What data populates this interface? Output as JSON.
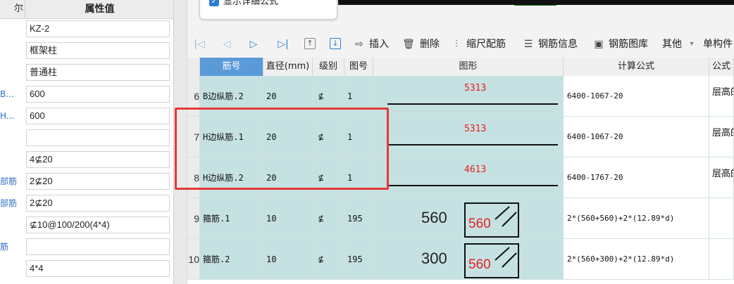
{
  "left_panel": {
    "header": {
      "name_col": "尔",
      "value_col": "属性值"
    },
    "rows": [
      {
        "name": "",
        "value": "KZ-2"
      },
      {
        "name": "",
        "value": "框架柱"
      },
      {
        "name": "",
        "value": "普通柱"
      },
      {
        "name": "B...",
        "value": "600"
      },
      {
        "name": "H...",
        "value": "600"
      },
      {
        "name": "",
        "value": ""
      },
      {
        "name": "",
        "value": "4⊈20"
      },
      {
        "name": "部筋",
        "value": "2⊈20"
      },
      {
        "name": "部筋",
        "value": "2⊈20"
      },
      {
        "name": "",
        "value": "⊈10@100/200(4*4)"
      },
      {
        "name": "筋",
        "value": ""
      },
      {
        "name": "",
        "value": "4*4"
      }
    ]
  },
  "popup": {
    "checkbox_label": "显示详细公式",
    "checked": true
  },
  "toolbar": {
    "insert": "插入",
    "delete": "删除",
    "scale_rebar": "缩尺配筋",
    "rebar_info": "钢筋信息",
    "rebar_library": "钢筋图库",
    "other": "其他",
    "unit_component": "单构件"
  },
  "grid": {
    "columns": [
      "筋号",
      "直径(mm)",
      "级别",
      "图号",
      "图形",
      "计算公式",
      "公式"
    ],
    "rows": [
      {
        "index": "6",
        "name": "B边纵筋.2",
        "diameter": "20",
        "grade": "⊈",
        "shape_no": "1",
        "shape_type": "line",
        "shape_value": "5313",
        "formula": "6400-1067-20",
        "note": "层高的露"
      },
      {
        "index": "7",
        "name": "H边纵筋.1",
        "diameter": "20",
        "grade": "⊈",
        "shape_no": "1",
        "shape_type": "line",
        "shape_value": "5313",
        "formula": "6400-1067-20",
        "note": "层高的露"
      },
      {
        "index": "8",
        "name": "H边纵筋.2",
        "diameter": "20",
        "grade": "⊈",
        "shape_no": "1",
        "shape_type": "line",
        "shape_value": "4613",
        "formula": "6400-1767-20",
        "note": "层高的露"
      },
      {
        "index": "9",
        "name": "箍筋.1",
        "diameter": "10",
        "grade": "⊈",
        "shape_no": "195",
        "shape_type": "stirrup",
        "shape_side": "560",
        "shape_inner": "560",
        "formula": "2*(560+560)+2*(12.89*d)",
        "note": ""
      },
      {
        "index": "10",
        "name": "箍筋.2",
        "diameter": "10",
        "grade": "⊈",
        "shape_no": "195",
        "shape_type": "stirrup",
        "shape_side": "300",
        "shape_inner": "560",
        "formula": "2*(560+300)+2*(12.89*d)",
        "note": ""
      }
    ]
  },
  "colors": {
    "row_bg": "#c6e1e2",
    "header_selected": "#5a9ad8",
    "highlight": "#e53935",
    "accent": "#2b7cd3"
  }
}
